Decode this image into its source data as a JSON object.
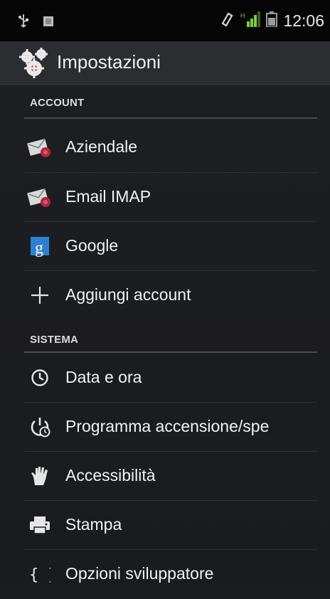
{
  "status_bar": {
    "time": "12:06",
    "left_icons": [
      "usb-icon",
      "notification-icon"
    ],
    "right_icons": [
      "sync-icon",
      "signal-icon",
      "battery-icon"
    ]
  },
  "action_bar": {
    "title": "Impostazioni",
    "icon": "settings-gears-icon"
  },
  "sections": [
    {
      "header": "ACCOUNT",
      "items": [
        {
          "label": "Aziendale",
          "icon": "exchange-mail-icon"
        },
        {
          "label": "Email IMAP",
          "icon": "email-icon"
        },
        {
          "label": "Google",
          "icon": "google-icon"
        },
        {
          "label": "Aggiungi account",
          "icon": "add-icon"
        }
      ]
    },
    {
      "header": "SISTEMA",
      "items": [
        {
          "label": "Data e ora",
          "icon": "clock-icon"
        },
        {
          "label": "Programma accensione/spe",
          "icon": "power-schedule-icon"
        },
        {
          "label": "Accessibilità",
          "icon": "hand-icon"
        },
        {
          "label": "Stampa",
          "icon": "printer-icon"
        },
        {
          "label": "Opzioni sviluppatore",
          "icon": "braces-icon"
        }
      ]
    }
  ],
  "colors": {
    "background": "#1b1c1e",
    "status_bar": "#050505",
    "action_bar": "#2c2d30",
    "signal_green": "#7ccf2a",
    "text": "#f2f2f2"
  }
}
